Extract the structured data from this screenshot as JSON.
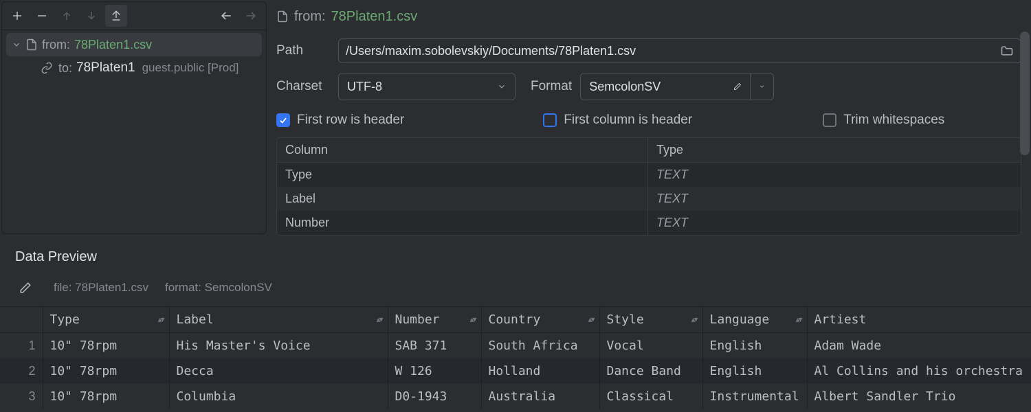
{
  "sidebar": {
    "from_prefix": "from:",
    "from_file": "78Platen1.csv",
    "to_prefix": "to:",
    "to_target": "78Platen1",
    "to_schema": "guest.public [Prod]"
  },
  "crumb": {
    "from_prefix": "from:",
    "file": "78Platen1.csv"
  },
  "form": {
    "path_label": "Path",
    "path_value": "/Users/maxim.sobolevskiy/Documents/78Platen1.csv",
    "charset_label": "Charset",
    "charset_value": "UTF-8",
    "format_label": "Format",
    "format_value": "SemcolonSV"
  },
  "checks": {
    "first_row": "First row is header",
    "first_col": "First column is header",
    "trim": "Trim whitespaces"
  },
  "col_table": {
    "h_column": "Column",
    "h_type": "Type",
    "rows": [
      {
        "name": "Type",
        "dtype": "TEXT"
      },
      {
        "name": "Label",
        "dtype": "TEXT"
      },
      {
        "name": "Number",
        "dtype": "TEXT"
      }
    ]
  },
  "preview": {
    "title": "Data Preview",
    "file_label": "file: 78Platen1.csv",
    "format_label": "format: SemcolonSV",
    "columns": [
      "Type",
      "Label",
      "Number",
      "Country",
      "Style",
      "Language",
      "Artiest"
    ],
    "rows": [
      [
        "10\" 78rpm",
        "His Master's Voice",
        "SAB 371",
        "South Africa",
        "Vocal",
        "English",
        "Adam Wade"
      ],
      [
        "10\" 78rpm",
        "Decca",
        "W 126",
        "Holland",
        "Dance Band",
        "English",
        "Al Collins and his orchestra"
      ],
      [
        "10\" 78rpm",
        "Columbia",
        "D0-1943",
        "Australia",
        "Classical",
        "Instrumental",
        "Albert Sandler Trio"
      ]
    ]
  }
}
